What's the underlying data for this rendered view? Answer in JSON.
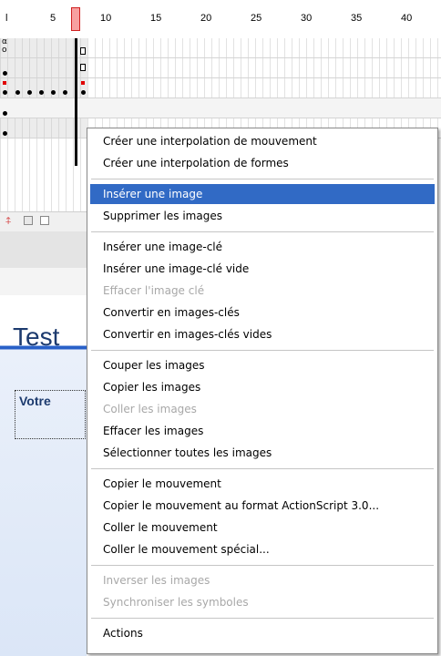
{
  "ruler": {
    "labels": [
      "l",
      "5",
      "10",
      "15",
      "20",
      "25",
      "30",
      "35",
      "40"
    ]
  },
  "stage": {
    "title": "Test",
    "text": "Votre"
  },
  "menu": {
    "groups": [
      [
        "Créer une interpolation de mouvement",
        "Créer une interpolation de formes"
      ],
      [
        "Insérer une image",
        "Supprimer les images"
      ],
      [
        "Insérer une image-clé",
        "Insérer une image-clé vide",
        "Effacer l'image clé",
        "Convertir en images-clés",
        "Convertir en images-clés vides"
      ],
      [
        "Couper les images",
        "Copier les images",
        "Coller les images",
        "Effacer les images",
        "Sélectionner toutes les images"
      ],
      [
        "Copier le mouvement",
        "Copier le mouvement au format ActionScript 3.0...",
        "Coller le mouvement",
        "Coller le mouvement spécial..."
      ],
      [
        "Inverser les images",
        "Synchroniser les symboles"
      ],
      [
        "Actions"
      ]
    ],
    "selected": "Insérer une image",
    "disabled": [
      "Effacer l'image clé",
      "Coller les images",
      "Inverser les images",
      "Synchroniser les symboles"
    ]
  },
  "colors": {
    "selection": "#316ac5",
    "playhead": "#f7a0a0",
    "stage_title": "#1c3a6e"
  }
}
